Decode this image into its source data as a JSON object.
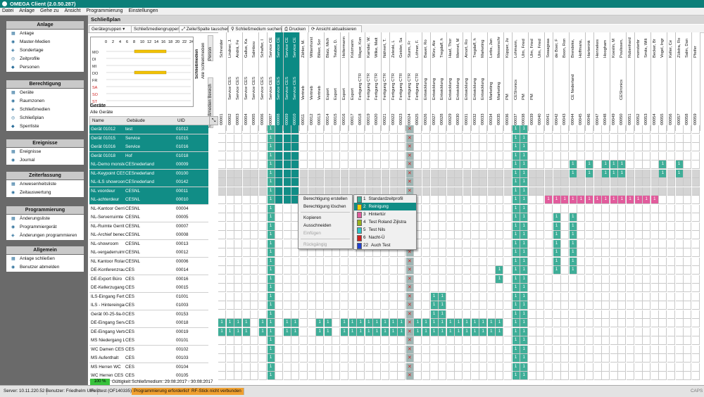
{
  "window": {
    "title": "OMEGA Client  (2.0.50.287)"
  },
  "menubar": {
    "items": [
      "Datei",
      "Anlage",
      "Gehe zu",
      "Ansicht",
      "Programmierung",
      "Einstellungen"
    ]
  },
  "sidebar": {
    "sections": [
      {
        "title": "Anlage",
        "items": [
          "Anlage",
          "Master-Medien",
          "Sondertage",
          "Zeitprofile",
          "Personen"
        ]
      },
      {
        "title": "Berechtigung",
        "items": [
          "Geräte",
          "Raumzonen",
          "Schließmedien",
          "Schließplan",
          "Sperrliste"
        ]
      },
      {
        "title": "Ereignisse",
        "items": [
          "Ereignisse",
          "Journal"
        ]
      },
      {
        "title": "Zeiterfassung",
        "items": [
          "Anwesenheitsliste",
          "Zeitauswertung"
        ]
      },
      {
        "title": "Programmierung",
        "items": [
          "Änderungsliste",
          "Programmiergerät",
          "Änderungen programmieren"
        ]
      },
      {
        "title": "Allgemein",
        "items": [
          "Anlage schließen",
          "Benutzer abmelden"
        ]
      }
    ]
  },
  "page": {
    "title": "Schließplan"
  },
  "toolbar": {
    "device_groups": "Gerätegruppen",
    "media_groups": "Schließmediengruppen",
    "swap": "Zeile/Spalte tauschen",
    "search": "Schließmedium suchen",
    "print": "Drucken",
    "refresh": "Ansicht aktualisieren"
  },
  "week": {
    "hours": [
      "0",
      "2",
      "4",
      "6",
      "8",
      "10",
      "12",
      "14",
      "16",
      "18",
      "20",
      "22",
      "24"
    ],
    "days": [
      "MO",
      "DI",
      "MI",
      "DO",
      "FR",
      "SA",
      "SO",
      "ST"
    ],
    "colors": {
      "weekday": "#222222",
      "weekend": "#d02020",
      "bar": "#f2c200"
    }
  },
  "left_labels": {
    "schliessmedien": "Schließmedien",
    "alle": "Alle Schließmedien",
    "bereich": "Schließmedien Bereich",
    "person": "Person"
  },
  "devices": {
    "title": "Geräte",
    "filter": "Alle Geräte",
    "columns": {
      "name": "Name",
      "building": "Gebäude",
      "uid": "UID"
    },
    "rows": [
      {
        "name": "Gerät 01012",
        "building": "test",
        "uid": "01012",
        "sel": true
      },
      {
        "name": "Gerät 01015",
        "building": "Service",
        "uid": "01015",
        "sel": true
      },
      {
        "name": "Gerät 01016",
        "building": "Service",
        "uid": "01016",
        "sel": true
      },
      {
        "name": "Gerät 01018",
        "building": "Hof",
        "uid": "01018",
        "sel": true
      },
      {
        "name": "NL-Demo monstert",
        "building": "CESnederland",
        "uid": "00009",
        "sel": true
      },
      {
        "name": "NL-Keypoint CESN",
        "building": "CESnederland",
        "uid": "00100",
        "sel": true
      },
      {
        "name": "NL-ILS showroom",
        "building": "CESnederland",
        "uid": "00142",
        "sel": true
      },
      {
        "name": "NL voordeur",
        "building": "CESNL",
        "uid": "00011",
        "sel": true
      },
      {
        "name": "NL-achterdeur",
        "building": "CESNL",
        "uid": "00010",
        "sel": true
      },
      {
        "name": "NL-Kantoor Gerrit",
        "building": "CESNL",
        "uid": "00004",
        "sel": false
      },
      {
        "name": "NL-Serverruimte",
        "building": "CESNL",
        "uid": "00005",
        "sel": false
      },
      {
        "name": "NL-Ruimte Gerrit",
        "building": "CESNL",
        "uid": "00007",
        "sel": false
      },
      {
        "name": "NL-Archief beneden",
        "building": "CESNL",
        "uid": "00008",
        "sel": false
      },
      {
        "name": "NL-showroom",
        "building": "CESNL",
        "uid": "00013",
        "sel": false
      },
      {
        "name": "NL-vergaderruimte",
        "building": "CESNL",
        "uid": "00012",
        "sel": false
      },
      {
        "name": "NL Kantoor Roland",
        "building": "CESNL",
        "uid": "00006",
        "sel": false
      },
      {
        "name": "DE-Konferenzraum",
        "building": "CES",
        "uid": "00014",
        "sel": false
      },
      {
        "name": "DE-Export Büro",
        "building": "CES",
        "uid": "00016",
        "sel": false
      },
      {
        "name": "DE-Kellerzugang L",
        "building": "CES",
        "uid": "00015",
        "sel": false
      },
      {
        "name": "ILS-Eingang Fertig",
        "building": "CES",
        "uid": "01001",
        "sel": false
      },
      {
        "name": "ILS - Hintereingang",
        "building": "CES",
        "uid": "01003",
        "sel": false
      },
      {
        "name": "Gerät 00-25-9a-00",
        "building": "CES",
        "uid": "00153",
        "sel": false
      },
      {
        "name": "DE-Eingang Service",
        "building": "CES",
        "uid": "00018",
        "sel": false
      },
      {
        "name": "DE-Eingang Vertrie",
        "building": "CES",
        "uid": "00019",
        "sel": false
      },
      {
        "name": "MS Niedergang Lo",
        "building": "CES",
        "uid": "00101",
        "sel": false
      },
      {
        "name": "WC Damen CES",
        "building": "CES",
        "uid": "00102",
        "sel": false
      },
      {
        "name": "MS Aufenthalt",
        "building": "CES",
        "uid": "00103",
        "sel": false
      },
      {
        "name": "MS Herren WC",
        "building": "CES",
        "uid": "00104",
        "sel": false
      },
      {
        "name": "WC Herren CES",
        "building": "CES",
        "uid": "00105",
        "sel": false
      }
    ]
  },
  "media_columns": [
    {
      "person": "Schneider",
      "bereich": "",
      "id": "0000001"
    },
    {
      "person": "Lindner, J.",
      "bereich": "Service CES",
      "id": "0000002"
    },
    {
      "person": "Andrä, Fe",
      "bereich": "Service CES",
      "id": "0000003"
    },
    {
      "person": "Gallus, Ka",
      "bereich": "Service CES",
      "id": "0000004"
    },
    {
      "person": "Salmbou",
      "bereich": "Service CES",
      "id": "0000005"
    },
    {
      "person": "Schaffer, I",
      "bereich": "Service CES",
      "id": "0000006"
    },
    {
      "person": "Service CE",
      "bereich": "Service CES",
      "id": "0000007"
    },
    {
      "person": "Service CE",
      "bereich": "Service CES",
      "id": "0000008",
      "sel": true
    },
    {
      "person": "Service CE",
      "bereich": "Service CES",
      "id": "0000009",
      "sel": true
    },
    {
      "person": "Service CE",
      "bereich": "Service CES",
      "id": "0000010",
      "sel": true
    },
    {
      "person": "Zähler, M.",
      "bereich": "Vertrieb",
      "id": "0000011"
    },
    {
      "person": "Wittenhorst",
      "bereich": "Vertrieb",
      "id": "0000012"
    },
    {
      "person": "Bilker, Sor",
      "bereich": "Vertrieb",
      "id": "0000013"
    },
    {
      "person": "Blatz, Mich",
      "bereich": "Export",
      "id": "0000014"
    },
    {
      "person": "Teuber, D.",
      "bereich": "Export",
      "id": "0000015"
    },
    {
      "person": "Holtermann",
      "bereich": "Export",
      "id": "0000016"
    },
    {
      "person": "Kolzmann",
      "bereich": "Export",
      "id": "0000017"
    },
    {
      "person": "Mayer, Kon",
      "bereich": "Fertigung CTR",
      "id": "0000018"
    },
    {
      "person": "Kamdar, W.",
      "bereich": "Fertigung CTR",
      "id": "0000019"
    },
    {
      "person": "Wilke, Matt",
      "bereich": "Fertigung CTR",
      "id": "0000020"
    },
    {
      "person": "Nährert, T.",
      "bereich": "Fertigung CTR",
      "id": "0000021"
    },
    {
      "person": "Zeleski, L",
      "bereich": "Fertigung CTR",
      "id": "0000022"
    },
    {
      "person": "Geisler, Sa",
      "bereich": "Fertigung CTR",
      "id": "0000023"
    },
    {
      "person": "Sturm, Fr",
      "bereich": "Fertigung CTR",
      "id": "0000024"
    },
    {
      "person": "Löhner, F.",
      "bereich": "Fertigung CTR",
      "id": "0000025"
    },
    {
      "person": "Bauer, Ro",
      "bereich": "Entwicklung",
      "id": "0000026"
    },
    {
      "person": "Würz, Ale",
      "bereich": "Entwicklung",
      "id": "0000027"
    },
    {
      "person": "Tregdaff, h",
      "bereich": "Entwicklung",
      "id": "0000028"
    },
    {
      "person": "Haaf, Thor",
      "bereich": "Entwicklung",
      "id": "0000029"
    },
    {
      "person": "Mennet, M",
      "bereich": "Entwicklung",
      "id": "0000030"
    },
    {
      "person": "Amort, Ro",
      "bereich": "Entwicklung",
      "id": "0000031"
    },
    {
      "person": "Tregdaff, h",
      "bereich": "Entwicklung",
      "id": "0000032"
    },
    {
      "person": "Marketing",
      "bereich": "Entwicklung",
      "id": "0000033"
    },
    {
      "person": "Lerbs, Jan",
      "bereich": "Marketing",
      "id": "0000034"
    },
    {
      "person": "Messerschr",
      "bereich": "Marketing",
      "id": "0000035"
    },
    {
      "person": "Küpper, Ju",
      "bereich": "PM",
      "id": "0000036"
    },
    {
      "person": "Lohmann,",
      "bereich": "CESIronics",
      "id": "0000037"
    },
    {
      "person": "Ulm, Fried",
      "bereich": "PM",
      "id": "0000038"
    },
    {
      "person": "Ulm, Fried",
      "bereich": "PM",
      "id": "0000039"
    },
    {
      "person": "Ulm, Fried",
      "bereich": "",
      "id": "0000040"
    },
    {
      "person": "Swaagsaa",
      "bereich": "",
      "id": "0000041"
    },
    {
      "person": "de Boer, F",
      "bereich": "",
      "id": "0000042"
    },
    {
      "person": "Boon, Ron",
      "bereich": "",
      "id": "0000043"
    },
    {
      "person": "Brendeke,",
      "bereich": "CE Nederland",
      "id": "0000044"
    },
    {
      "person": "Hoffmans,",
      "bereich": "",
      "id": "0000045"
    },
    {
      "person": "Hartenink",
      "bereich": "",
      "id": "0000046"
    },
    {
      "person": "Hennekes",
      "bereich": "",
      "id": "0000047"
    },
    {
      "person": "Hoogham",
      "bereich": "",
      "id": "0000048"
    },
    {
      "person": "Koeslin, M",
      "bereich": "",
      "id": "0000049"
    },
    {
      "person": "Poulissen,",
      "bereich": "CESIronics",
      "id": "0000050"
    },
    {
      "person": "Rubenhard",
      "bereich": "",
      "id": "0000051"
    },
    {
      "person": "monsterbr",
      "bereich": "",
      "id": "0000052"
    },
    {
      "person": "Smits, Wilt",
      "bereich": "",
      "id": "0000053"
    },
    {
      "person": "Becker, Br",
      "bereich": "",
      "id": "0000054"
    },
    {
      "person": "Vogel, Ingr",
      "bereich": "",
      "id": "0000055"
    },
    {
      "person": "Keller, Ce",
      "bereich": "",
      "id": "0000056"
    },
    {
      "person": "Zülstra, Ro",
      "bereich": "",
      "id": "0000057"
    },
    {
      "person": "Salm, Dan",
      "bereich": "",
      "id": "0000058"
    },
    {
      "person": "Pfeifer",
      "bereich": "",
      "id": "0000059"
    }
  ],
  "context_menu": {
    "items": [
      "Berechtigung erstellen",
      "Berechtigung löschen",
      "Kopieren",
      "Ausschneiden",
      "Einfügen",
      "Rückgängig"
    ],
    "disabled": [
      false,
      false,
      false,
      false,
      true,
      true
    ]
  },
  "submenu": {
    "items": [
      {
        "num": "1",
        "label": "Standardzeitprofil",
        "color": "#3fae98"
      },
      {
        "num": "2",
        "label": "Reinigung",
        "color": "#f2d000"
      },
      {
        "num": "3",
        "label": "Hintertür",
        "color": "#e15c9c"
      },
      {
        "num": "4",
        "label": "Test Roland Zijlstra",
        "color": "#9ab21e"
      },
      {
        "num": "5",
        "label": "Test Nils",
        "color": "#2bc3c8"
      },
      {
        "num": "6",
        "label": "Nacht-Ü",
        "color": "#d02020"
      },
      {
        "num": "22",
        "label": "Auch Test",
        "color": "#2040d0"
      }
    ]
  },
  "bottom": {
    "progress": "100 %",
    "validity": "Gültigkeit Schließmedium: 29.08.2017 - 30.08.2017"
  },
  "status": {
    "server": "Server: 10.11.220.52",
    "user": "Benutzer: Friedhelm Ulm",
    "feldtest": "Feldtest (OF140335)",
    "prog": "Programmierung erforderlich",
    "rf": "RF-Stick nicht verbunden",
    "caps": "CAPS",
    "warn_color": "#f0a030"
  }
}
